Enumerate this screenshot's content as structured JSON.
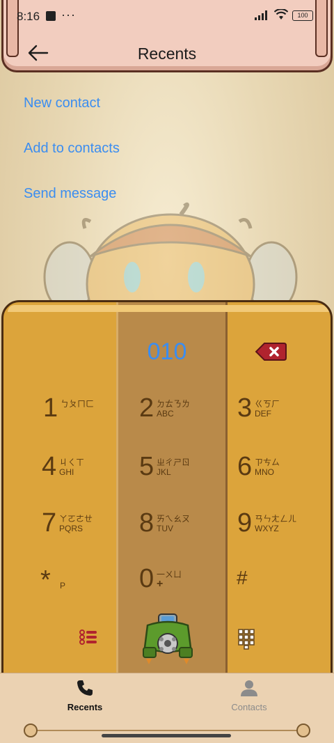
{
  "status_bar": {
    "time": "8:16",
    "more": "···",
    "battery": "100"
  },
  "header": {
    "title": "Recents"
  },
  "options": [
    {
      "label": "New contact"
    },
    {
      "label": "Add to contacts"
    },
    {
      "label": "Send message"
    }
  ],
  "dialer": {
    "entered_number": "010",
    "keys": [
      {
        "num": "1",
        "zhuyin": "ㄅㄆㄇㄈ",
        "letters": ""
      },
      {
        "num": "2",
        "zhuyin": "ㄉㄊㄋㄌ",
        "letters": "ABC"
      },
      {
        "num": "3",
        "zhuyin": "ㄍㄎㄏ",
        "letters": "DEF"
      },
      {
        "num": "4",
        "zhuyin": "ㄐㄑㄒ",
        "letters": "GHI"
      },
      {
        "num": "5",
        "zhuyin": "ㄓㄔㄕㄖ",
        "letters": "JKL"
      },
      {
        "num": "6",
        "zhuyin": "ㄗㄘㄙ",
        "letters": "MNO"
      },
      {
        "num": "7",
        "zhuyin": "ㄚㄛㄜㄝ",
        "letters": "PQRS"
      },
      {
        "num": "8",
        "zhuyin": "ㄞㄟㄠㄡ",
        "letters": "TUV"
      },
      {
        "num": "9",
        "zhuyin": "ㄢㄣㄤㄥㄦ",
        "letters": "WXYZ"
      },
      {
        "num": "*",
        "zhuyin": "",
        "letters": "P"
      },
      {
        "num": "0",
        "zhuyin": "一ㄨㄩ",
        "letters": "+"
      },
      {
        "num": "#",
        "zhuyin": "",
        "letters": ""
      }
    ]
  },
  "bottom_nav": {
    "recents_label": "Recents",
    "contacts_label": "Contacts",
    "active": "Recents"
  },
  "colors": {
    "accent": "#3b8df0",
    "keypad": "#dca43b",
    "keypad_mid": "#b98a4a",
    "header": "#f2cdbf"
  }
}
